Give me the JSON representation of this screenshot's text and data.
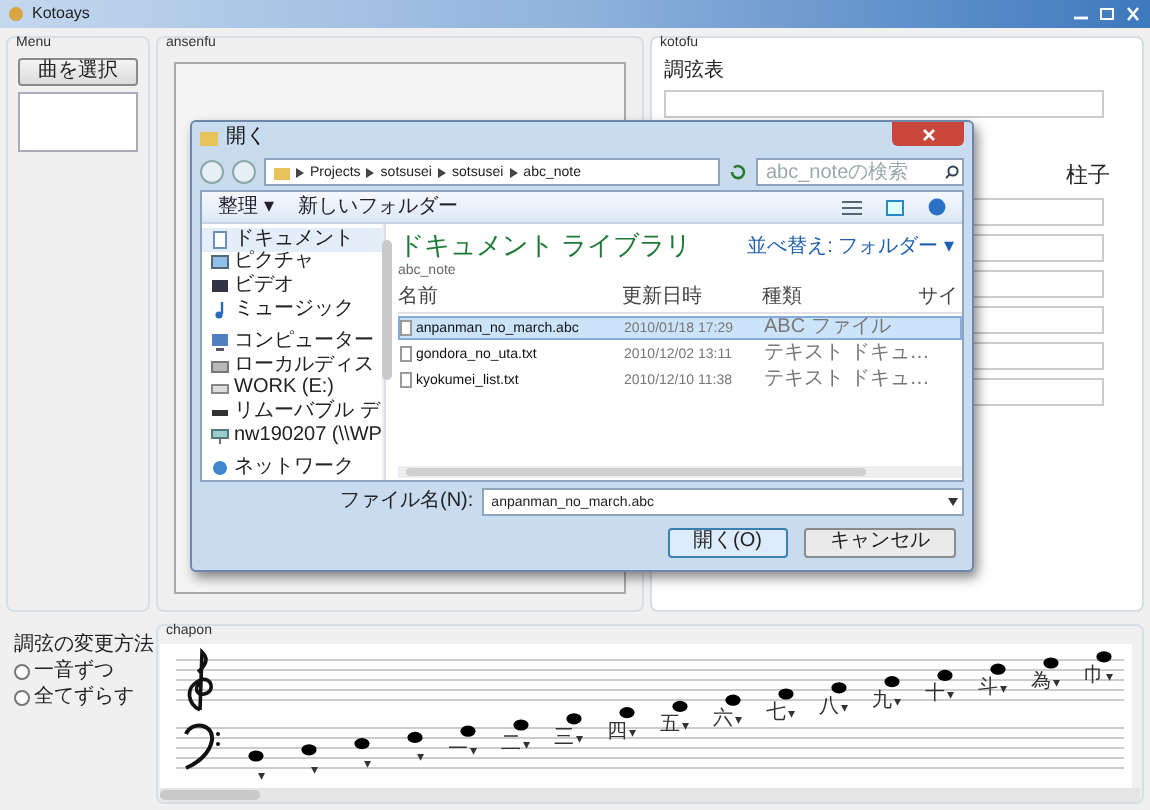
{
  "window": {
    "title": "Kotoays"
  },
  "menu": {
    "label": "Menu",
    "button": "曲を選択"
  },
  "ansenfu": {
    "label": "ansenfu"
  },
  "kotofu": {
    "label": "kotofu",
    "tuning_label": "調弦表",
    "bridge_label": "柱子"
  },
  "tuning_change": {
    "label": "調弦の変更方法",
    "options": [
      {
        "label": "一音ずつ",
        "selected": false
      },
      {
        "label": "全てずらす",
        "selected": false
      }
    ]
  },
  "chapon": {
    "label": "chapon",
    "notes": [
      {
        "arrow": "▾"
      },
      {
        "arrow": "▾"
      },
      {
        "arrow": "▾"
      },
      {
        "arrow": "▾"
      },
      {
        "label": "一",
        "arrow": "▾"
      },
      {
        "label": "二",
        "arrow": "▾"
      },
      {
        "label": "三",
        "arrow": "▾"
      },
      {
        "label": "四",
        "arrow": "▾"
      },
      {
        "label": "五",
        "arrow": "▾"
      },
      {
        "label": "六",
        "arrow": "▾"
      },
      {
        "label": "七",
        "arrow": "▾"
      },
      {
        "label": "八",
        "arrow": "▾"
      },
      {
        "label": "九",
        "arrow": "▾"
      },
      {
        "label": "十",
        "arrow": "▾"
      },
      {
        "label": "斗",
        "arrow": "▾"
      },
      {
        "label": "為",
        "arrow": "▾"
      },
      {
        "label": "巾",
        "arrow": "▾"
      }
    ]
  },
  "dialog": {
    "title": "開く",
    "breadcrumb": [
      "Projects",
      "sotsusei",
      "sotsusei",
      "abc_note"
    ],
    "search": {
      "placeholder": "abc_noteの検索"
    },
    "toolbar": {
      "organize": "整理 ▾",
      "new_folder": "新しいフォルダー"
    },
    "sidebar": [
      {
        "label": "ドキュメント",
        "kind": "documents",
        "selected": true
      },
      {
        "label": "ピクチャ",
        "kind": "pictures",
        "selected": false
      },
      {
        "label": "ビデオ",
        "kind": "videos",
        "selected": false
      },
      {
        "label": "ミュージック",
        "kind": "music",
        "selected": false
      },
      {
        "label": "コンピューター",
        "kind": "computer",
        "selected": false
      },
      {
        "label": "ローカルディス",
        "kind": "disk",
        "selected": false
      },
      {
        "label": "WORK (E:)",
        "kind": "drive",
        "selected": false
      },
      {
        "label": "リムーバブル デ",
        "kind": "removable",
        "selected": false
      },
      {
        "label": "nw190207 (\\\\WP",
        "kind": "share",
        "selected": false
      },
      {
        "label": "ネットワーク",
        "kind": "network",
        "selected": false
      }
    ],
    "library": {
      "title": "ドキュメント ライブラリ",
      "subtitle": "abc_note",
      "arrange": "並べ替え: フォルダー ▾"
    },
    "columns": [
      "名前",
      "更新日時",
      "種類",
      "サイ"
    ],
    "files": [
      {
        "name": "anpanman_no_march.abc",
        "date": "2010/01/18 17:29",
        "type": "ABC ファイル",
        "selected": true
      },
      {
        "name": "gondora_no_uta.txt",
        "date": "2010/12/02 13:11",
        "type": "テキスト ドキュ…",
        "selected": false
      },
      {
        "name": "kyokumei_list.txt",
        "date": "2010/12/10 11:38",
        "type": "テキスト ドキュ…",
        "selected": false
      }
    ],
    "filename": {
      "label": "ファイル名(N):",
      "value": "anpanman_no_march.abc"
    },
    "buttons": [
      "開く(O)",
      "キャンセル"
    ]
  }
}
